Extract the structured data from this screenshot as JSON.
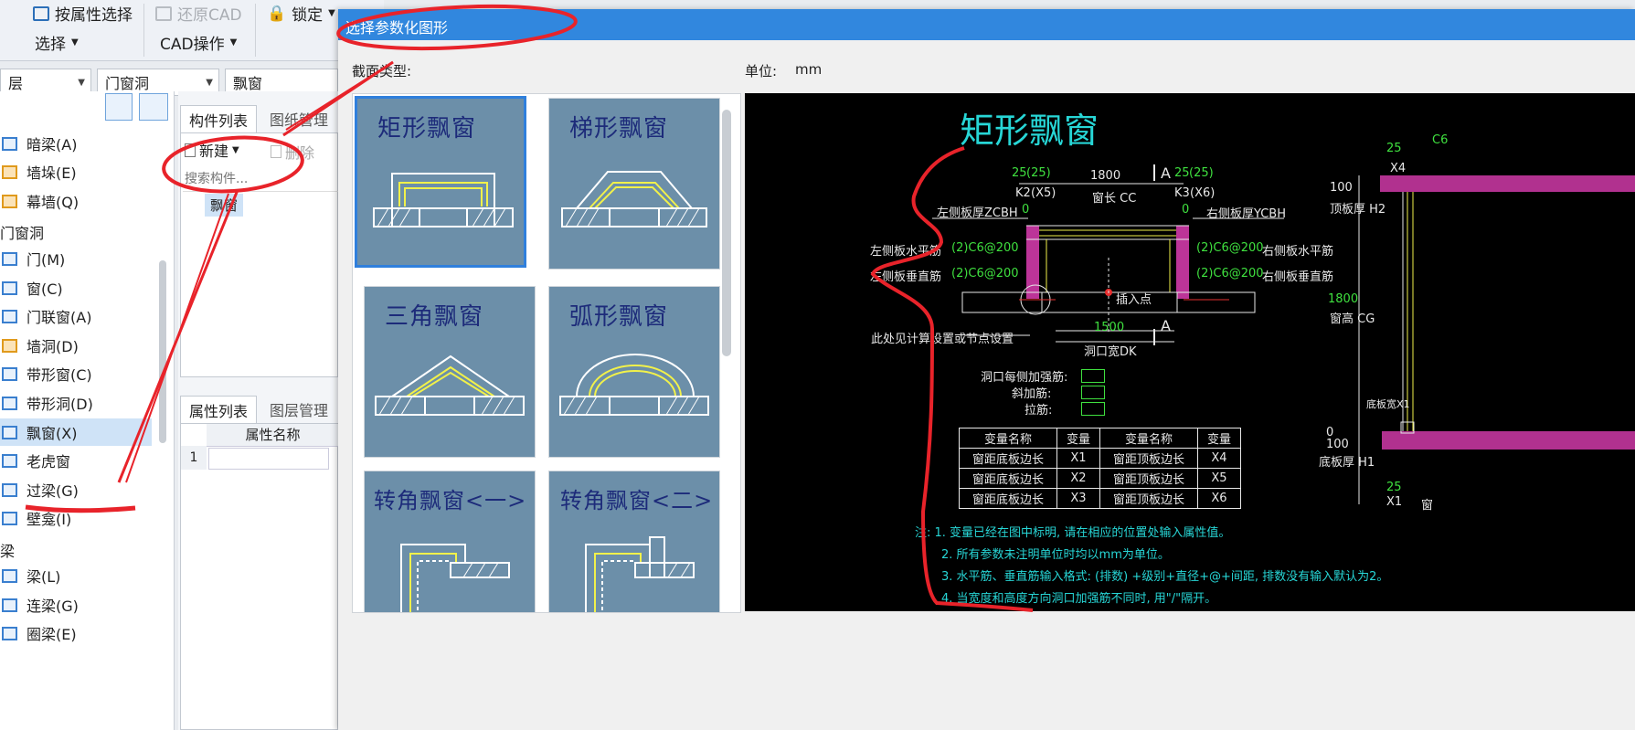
{
  "ribbon": {
    "by_attr_select": "按属性选择",
    "restore_cad": "还原CAD",
    "lock": "锁定",
    "select_group": "选择",
    "cad_ops_group": "CAD操作"
  },
  "filters": {
    "floor": "层",
    "category": "门窗洞",
    "type": "飘窗"
  },
  "tree": {
    "items_top": [
      {
        "label": "暗梁(A)"
      },
      {
        "label": "墙垛(E)"
      },
      {
        "label": "幕墙(Q)"
      }
    ],
    "group_window": "门窗洞",
    "items_window": [
      {
        "label": "门(M)"
      },
      {
        "label": "窗(C)"
      },
      {
        "label": "门联窗(A)"
      },
      {
        "label": "墙洞(D)"
      },
      {
        "label": "带形窗(C)"
      },
      {
        "label": "带形洞(D)"
      },
      {
        "label": "飘窗(X)"
      },
      {
        "label": "老虎窗"
      },
      {
        "label": "过梁(G)"
      },
      {
        "label": "壁龛(I)"
      }
    ],
    "group_beam": "梁",
    "items_beam": [
      {
        "label": "梁(L)"
      },
      {
        "label": "连梁(G)"
      },
      {
        "label": "圈梁(E)"
      }
    ]
  },
  "component_panel": {
    "tab_list": "构件列表",
    "tab_drawings": "图纸管理",
    "new_button": "新建",
    "delete_button": "删除",
    "search_placeholder": "搜索构件...",
    "item": "飘窗"
  },
  "property_panel": {
    "tab_props": "属性列表",
    "tab_layers": "图层管理",
    "col_name": "属性名称",
    "row_index": "1"
  },
  "dialog": {
    "title": "选择参数化图形",
    "section_type_label": "截面类型:",
    "unit_label": "单位:",
    "unit_value": "mm",
    "thumbnails": [
      {
        "name": "矩形飘窗",
        "selected": true
      },
      {
        "name": "梯形飘窗",
        "selected": false
      },
      {
        "name": "三角飘窗",
        "selected": false
      },
      {
        "name": "弧形飘窗",
        "selected": false
      },
      {
        "name": "转角飘窗<一>",
        "selected": false
      },
      {
        "name": "转角飘窗<二>",
        "selected": false
      }
    ]
  },
  "preview": {
    "title": "矩形飘窗",
    "dims": {
      "d25a": "25",
      "d25b": "(25)",
      "d1800": "1800",
      "secA": "A",
      "d25c": "25",
      "d25d": "(25)",
      "k2": "K2",
      "x5": "(X5)",
      "win_len": "窗长 CC",
      "k3": "K3",
      "x6": "(X6)",
      "left_thk": "左侧板厚ZCBH",
      "zero_l": "0",
      "zero_r": "0",
      "right_thk": "右侧板厚YCBH",
      "left_h_bar_label": "左侧板水平筋",
      "left_h_bar_val": "(2)C6@200",
      "right_h_bar_val": "(2)C6@200",
      "right_h_bar_label": "右侧板水平筋",
      "left_v_bar_label": "左侧板垂直筋",
      "left_v_bar_val": "(2)C6@200",
      "right_v_bar_val": "(2)C6@200",
      "right_v_bar_label": "右侧板垂直筋",
      "insert_point": "插入点",
      "d1500": "1500",
      "secA2": "A",
      "see_calc": "此处见计算设置或节点设置",
      "opening_w": "洞口宽DK",
      "r100": "100",
      "top_thk": "顶板厚 H2",
      "r1800": "1800",
      "win_h": "窗高 CG",
      "r25": "25",
      "rx4": "X4",
      "rc6": "C6",
      "r100b": "100",
      "bot_thk": "底板厚 H1",
      "r25b": "25",
      "rx1": "X1",
      "rwin": "窗",
      "rbase": "底板宽X1",
      "r0": "0"
    },
    "rebar_labels": [
      "洞口每侧加强筋:",
      "斜加筋:",
      "拉筋:"
    ],
    "var_table": {
      "headers": [
        "变量名称",
        "变量",
        "变量名称",
        "变量"
      ],
      "rows": [
        [
          "窗距底板边长",
          "X1",
          "窗距顶板边长",
          "X4"
        ],
        [
          "窗距底板边长",
          "X2",
          "窗距顶板边长",
          "X5"
        ],
        [
          "窗距底板边长",
          "X3",
          "窗距顶板边长",
          "X6"
        ]
      ]
    },
    "notes": [
      "注: 1. 变量已经在图中标明, 请在相应的位置处输入属性值。",
      "2. 所有参数未注明单位时均以mm为单位。",
      "3. 水平筋、垂直筋输入格式: (排数) +级别+直径+@+间距, 排数没有输入默认为2。",
      "4. 当宽度和高度方向洞口加强筋不同时, 用\"/\"隔开。"
    ]
  },
  "colors": {
    "title_bar": "#3187de",
    "annotation": "#e8232a",
    "thumb_bg": "#6c8fa9",
    "preview_bg": "#000000"
  }
}
